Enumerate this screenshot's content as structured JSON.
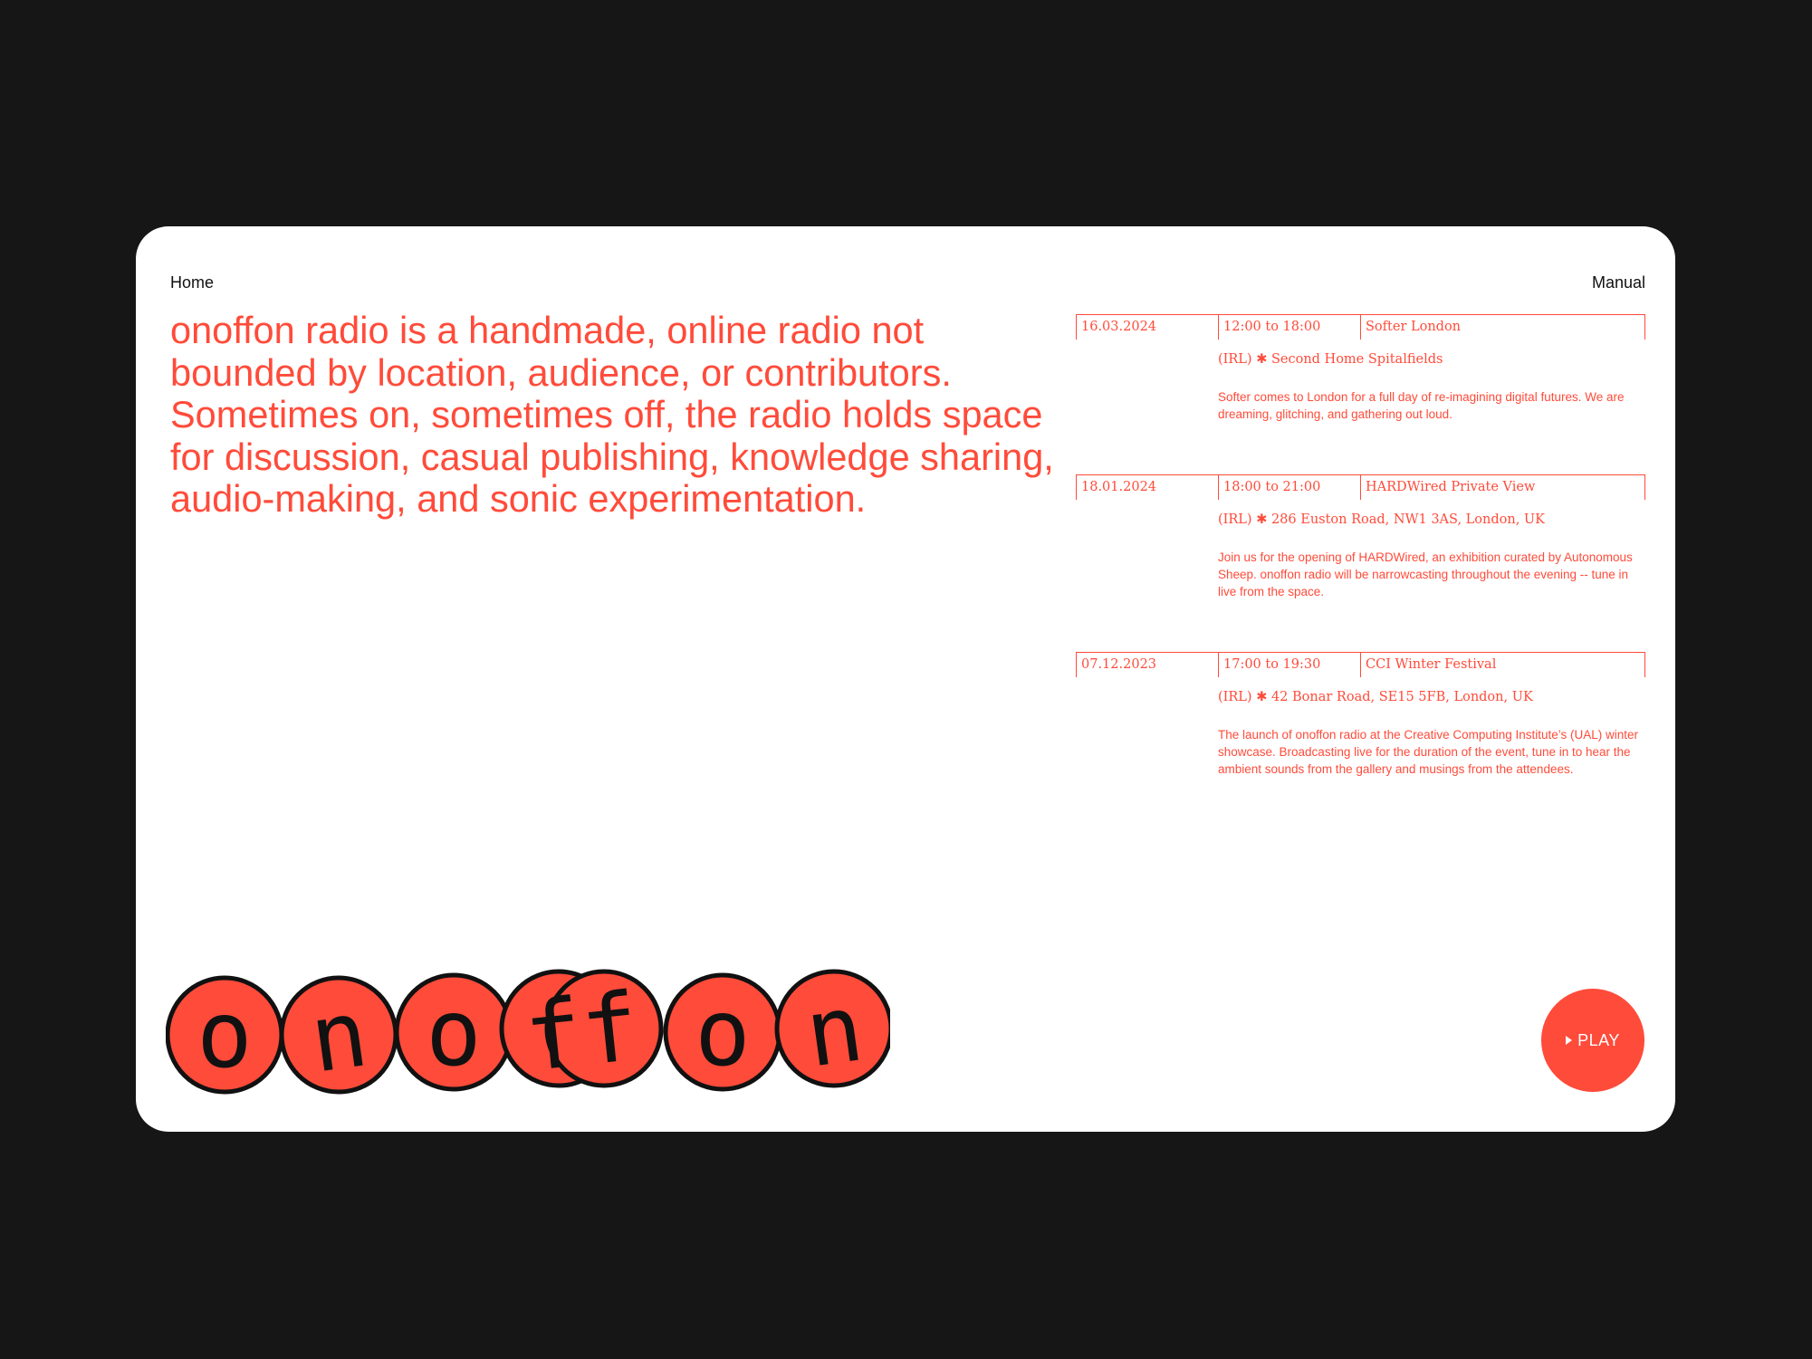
{
  "nav": {
    "home": "Home",
    "manual": "Manual"
  },
  "intro": {
    "text": "onoffon radio is a handmade, online radio not bounded by location, audience, or contributors. Sometimes on, sometimes off, the radio holds space for discussion, casual publishing, knowledge sharing, audio-making, and sonic experimentation."
  },
  "events": [
    {
      "date": "16.03.2024",
      "time": "12:00 to 18:00",
      "title": "Softer London",
      "location": "(IRL) ✱ Second Home Spitalfields",
      "description": "Softer comes to London for a full day of re-imagining digital futures. We are dreaming, glitching, and gathering out loud."
    },
    {
      "date": "18.01.2024",
      "time": "18:00 to 21:00",
      "title": "HARDWired Private View",
      "location": "(IRL) ✱ 286 Euston Road, NW1 3AS, London, UK",
      "description": "Join us for the opening of HARDWired, an exhibition curated by Autonomous Sheep. onoffon radio will be narrowcasting throughout the evening -- tune in live from the space."
    },
    {
      "date": "07.12.2023",
      "time": "17:00 to 19:30",
      "title": "CCI Winter Festival",
      "location": "(IRL) ✱ 42 Bonar Road, SE15 5FB, London, UK",
      "description": "The launch of onoffon radio at the Creative Computing Institute’s (UAL) winter showcase. Broadcasting live for the duration of the event, tune in to hear the ambient sounds from the gallery and musings from the attendees."
    }
  ],
  "logo": {
    "letters": [
      "o",
      "n",
      "o",
      "ff",
      "o",
      "n"
    ]
  },
  "play": {
    "label": "PLAY"
  },
  "colors": {
    "accent": "#ff4b3a",
    "background": "#161616",
    "card": "#ffffff",
    "text": "#111111"
  }
}
